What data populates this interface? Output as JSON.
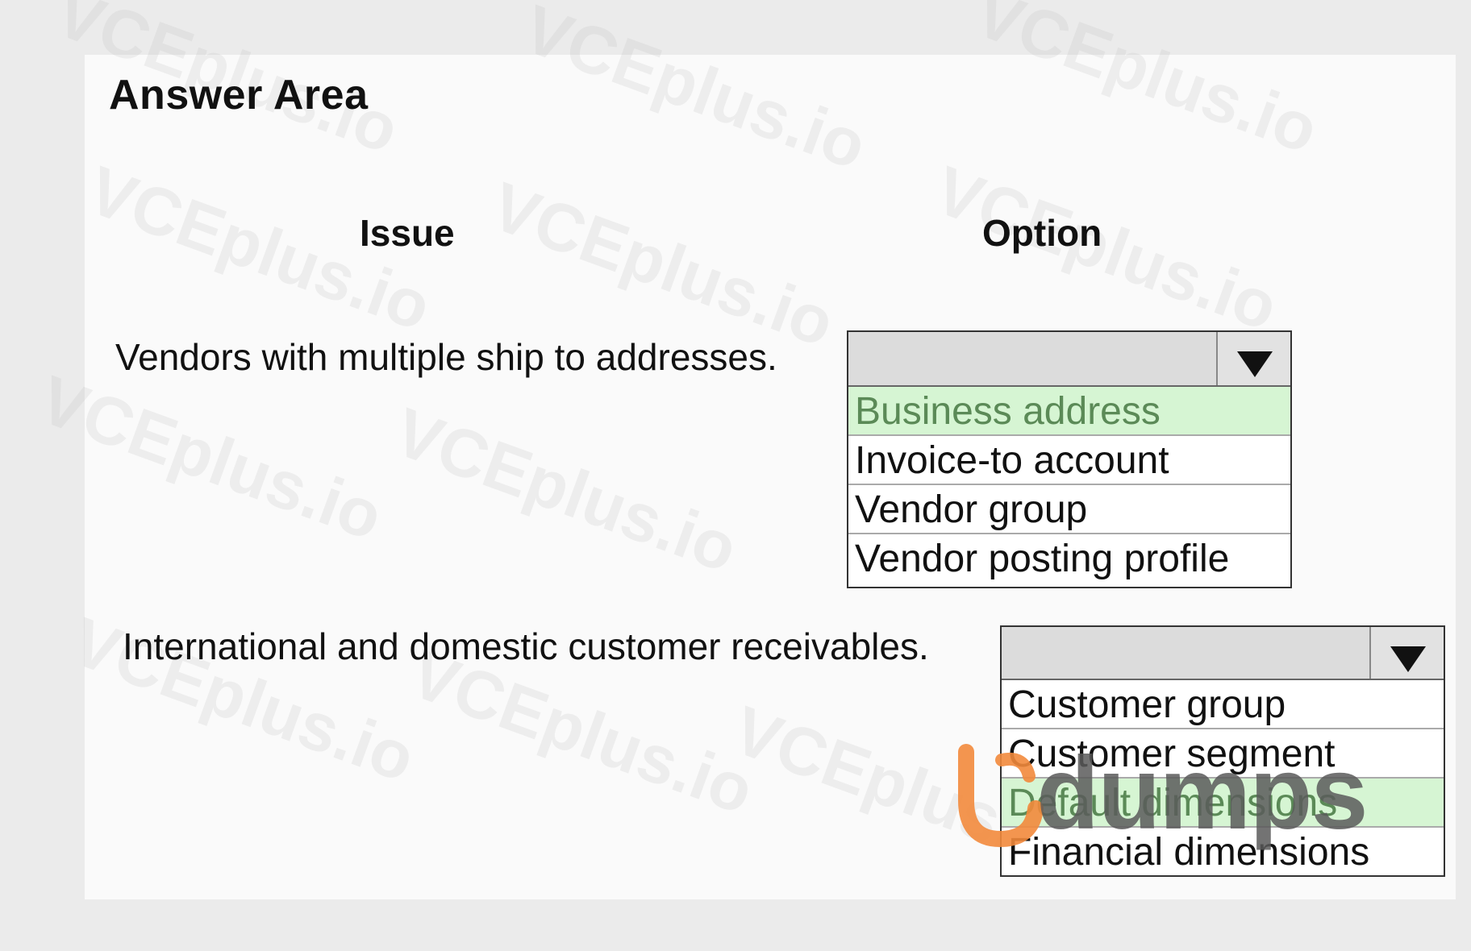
{
  "title": "Answer Area",
  "columns": {
    "issue": "Issue",
    "option": "Option"
  },
  "rows": [
    {
      "issue": "Vendors with multiple ship to addresses.",
      "options": [
        "Business address",
        "Invoice-to account",
        "Vendor group",
        "Vendor posting profile"
      ],
      "selected_option": "Business address"
    },
    {
      "issue": "International and domestic customer receivables.",
      "options": [
        "Customer group",
        "Customer segment",
        "Default dimensions",
        "Financial dimensions"
      ],
      "selected_option": "Default dimensions"
    }
  ],
  "watermark": {
    "text": "VCEplus.io",
    "color": "#bebebe"
  },
  "logo": {
    "text": "dumps",
    "accent_color": "#f28a3c"
  },
  "colors": {
    "selected_bg": "#d6f5d3",
    "selected_text": "#5b8a57",
    "dropdown_head": "#dcdcdc"
  }
}
